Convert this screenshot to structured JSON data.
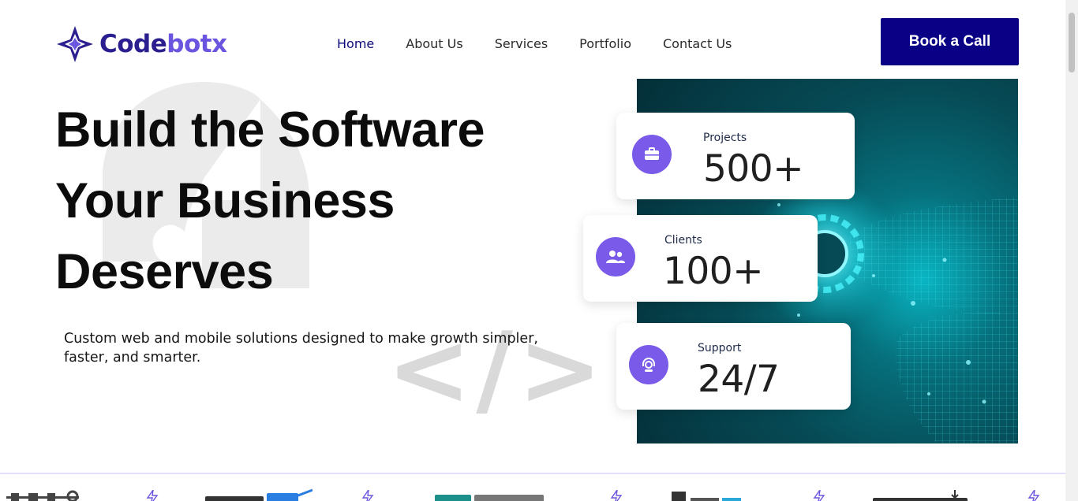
{
  "brand": {
    "name_part1": "Code",
    "name_part2": "botx"
  },
  "nav": {
    "items": [
      {
        "label": "Home",
        "active": true
      },
      {
        "label": "About Us",
        "active": false
      },
      {
        "label": "Services",
        "active": false
      },
      {
        "label": "Portfolio",
        "active": false
      },
      {
        "label": "Contact Us",
        "active": false
      }
    ]
  },
  "cta": {
    "label": "Book a Call"
  },
  "hero": {
    "title_lines": [
      "Build the Software",
      "Your Business",
      "Deserves"
    ],
    "subtitle": "Custom web and mobile solutions designed to make growth simpler, faster, and smarter.",
    "code_glyph": "</>"
  },
  "stats": [
    {
      "label": "Projects",
      "value": "500+",
      "icon": "briefcase-icon"
    },
    {
      "label": "Clients",
      "value": "100+",
      "icon": "users-icon"
    },
    {
      "label": "Support",
      "value": "24/7",
      "icon": "headset-icon"
    }
  ],
  "colors": {
    "brand_dark": "#0a0085",
    "brand_purple": "#7a5ae8",
    "nav_active": "#0c0a7a"
  }
}
